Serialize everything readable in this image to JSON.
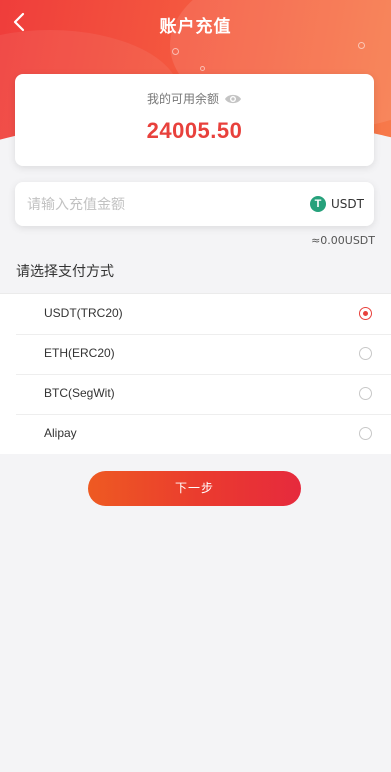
{
  "header": {
    "title": "账户充值",
    "back_icon": "chevron-left-icon",
    "accent_color": "#ef3d3b"
  },
  "balance": {
    "label": "我的可用余额",
    "amount": "24005.50",
    "eye_icon": "eye-icon",
    "amount_color": "#e8413c"
  },
  "recharge": {
    "input_placeholder": "请输入充值金额",
    "input_value": "",
    "currency_label": "USDT",
    "currency_icon": "tether-icon",
    "currency_symbol": "T",
    "estimate": "≈0.00USDT"
  },
  "payment": {
    "section_title": "请选择支付方式",
    "methods": [
      {
        "label": "USDT(TRC20)",
        "selected": true
      },
      {
        "label": "ETH(ERC20)",
        "selected": false
      },
      {
        "label": "BTC(SegWit)",
        "selected": false
      },
      {
        "label": "Alipay",
        "selected": false
      }
    ]
  },
  "actions": {
    "next_label": "下一步"
  }
}
